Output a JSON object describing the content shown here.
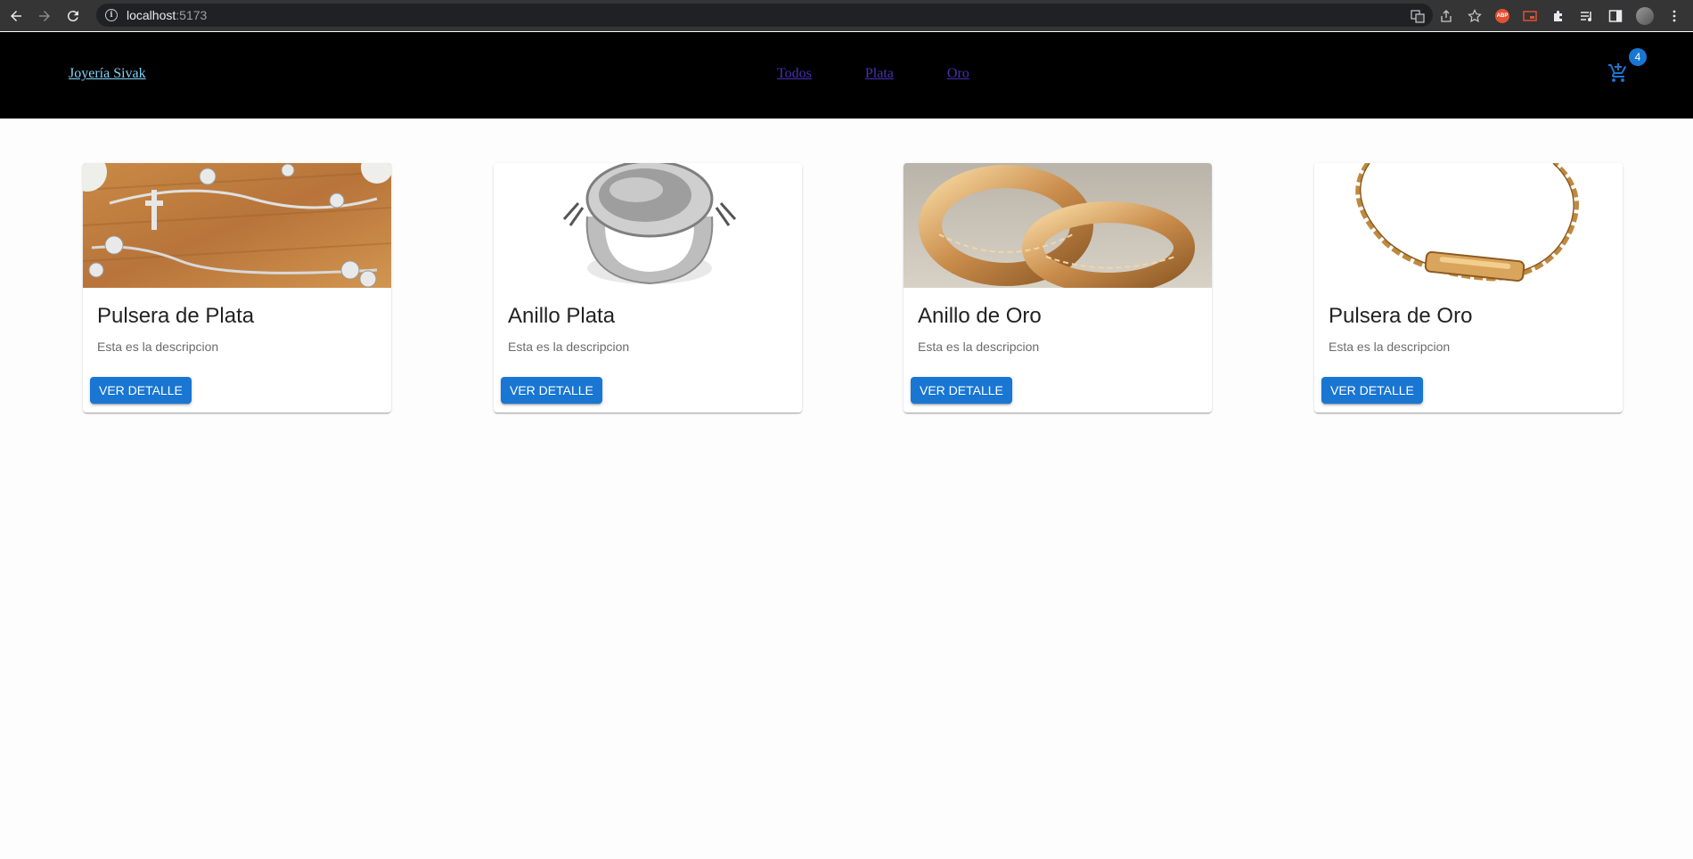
{
  "browser": {
    "url_host": "localhost",
    "url_port": ":5173"
  },
  "header": {
    "brand": "Joyería Sivak",
    "nav": [
      "Todos",
      "Plata",
      "Oro"
    ],
    "cart_count": "4"
  },
  "products": [
    {
      "title": "Pulsera de Plata",
      "description": "Esta es la descripcion",
      "button": "VER DETALLE",
      "image": "silver-bracelet-image"
    },
    {
      "title": "Anillo Plata",
      "description": "Esta es la descripcion",
      "button": "VER DETALLE",
      "image": "silver-ring-image"
    },
    {
      "title": "Anillo de Oro",
      "description": "Esta es la descripcion",
      "button": "VER DETALLE",
      "image": "gold-rings-image"
    },
    {
      "title": "Pulsera de Oro",
      "description": "Esta es la descripcion",
      "button": "VER DETALLE",
      "image": "gold-bracelet-image"
    }
  ]
}
